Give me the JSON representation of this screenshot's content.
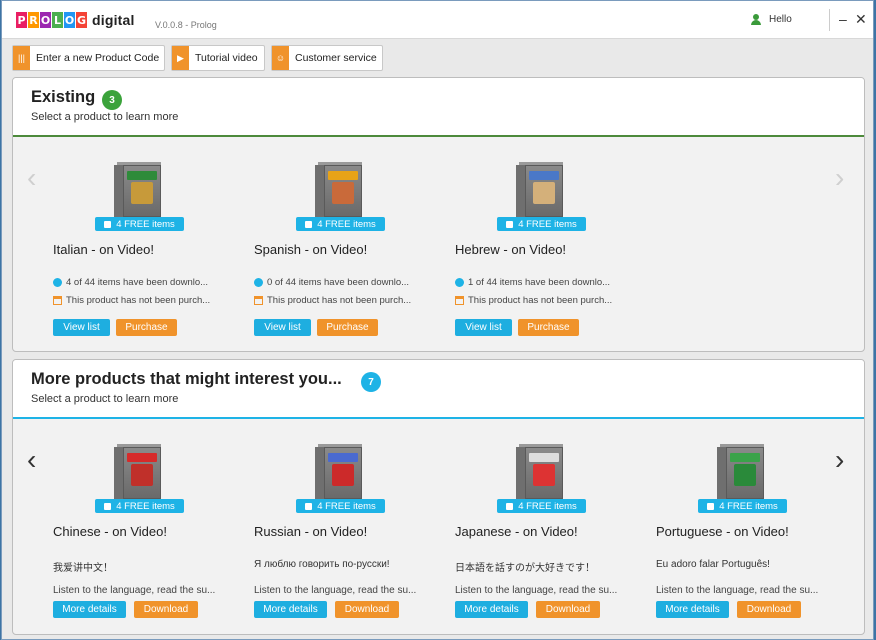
{
  "app": {
    "logo_letters": [
      "P",
      "R",
      "O",
      "L",
      "O",
      "G"
    ],
    "logo_word": "digital",
    "version": "V.0.0.8 - Prolog",
    "user_greeting": "Hello"
  },
  "colors": {
    "accent_blue": "#1eb3e6",
    "accent_orange": "#f0932b",
    "existing_badge": "#3ba33b",
    "logo": [
      "#e91e63",
      "#ff9800",
      "#9c27b0",
      "#4caf50",
      "#2196f3",
      "#f44336"
    ]
  },
  "window": {
    "minimize_label": "–",
    "close_label": "✕"
  },
  "toolbar": {
    "new_code_label": "Enter a new Product Code",
    "tutorial_label": "Tutorial video",
    "service_label": "Customer service"
  },
  "existing": {
    "title": "Existing",
    "count": "3",
    "subtitle": "Select a product to learn more",
    "prev_icon": "chevron-left-icon",
    "next_icon": "chevron-right-icon",
    "products": [
      {
        "name": "Italian - on Video!",
        "free": "4 FREE items",
        "downloaded": "4 of 44 items have been downlo...",
        "purchase_status": "This product has not been purch...",
        "view_label": "View list",
        "buy_label": "Purchase",
        "flag": "#2e8b3a",
        "face": "#c79a3a"
      },
      {
        "name": "Spanish - on Video!",
        "free": "4 FREE items",
        "downloaded": "0 of 44 items have been downlo...",
        "purchase_status": "This product has not been purch...",
        "view_label": "View list",
        "buy_label": "Purchase",
        "flag": "#e8a317",
        "face": "#c96a3a"
      },
      {
        "name": "Hebrew - on Video!",
        "free": "4 FREE items",
        "downloaded": "1 of 44 items have been downlo...",
        "purchase_status": "This product has not been purch...",
        "view_label": "View list",
        "buy_label": "Purchase",
        "flag": "#4a78c8",
        "face": "#d4b07a"
      }
    ]
  },
  "more": {
    "title": "More products that might interest you...",
    "count": "7",
    "subtitle": "Select a product to learn more",
    "products": [
      {
        "name": "Chinese - on Video!",
        "free": "4 FREE items",
        "quote": "我爱讲中文！",
        "desc": "Listen to the language, read the su...",
        "details_label": "More details",
        "download_label": "Download",
        "flag": "#d62a2a",
        "face": "#c0302a"
      },
      {
        "name": "Russian - on Video!",
        "free": "4 FREE items",
        "quote": "Я люблю говорить по-русски!",
        "desc": "Listen to the language, read the su...",
        "details_label": "More details",
        "download_label": "Download",
        "flag": "#4a6ad0",
        "face": "#cc2a2a"
      },
      {
        "name": "Japanese - on Video!",
        "free": "4 FREE items",
        "quote": "日本語を話すのが大好きです！",
        "desc": "Listen to the language, read the su...",
        "details_label": "More details",
        "download_label": "Download",
        "flag": "#dddddd",
        "face": "#d33"
      },
      {
        "name": "Portuguese - on Video!",
        "free": "4 FREE items",
        "quote": "Eu adoro falar Português!",
        "desc": "Listen to the language, read the su...",
        "details_label": "More details",
        "download_label": "Download",
        "flag": "#3aa34a",
        "face": "#2a8a3a"
      }
    ]
  }
}
